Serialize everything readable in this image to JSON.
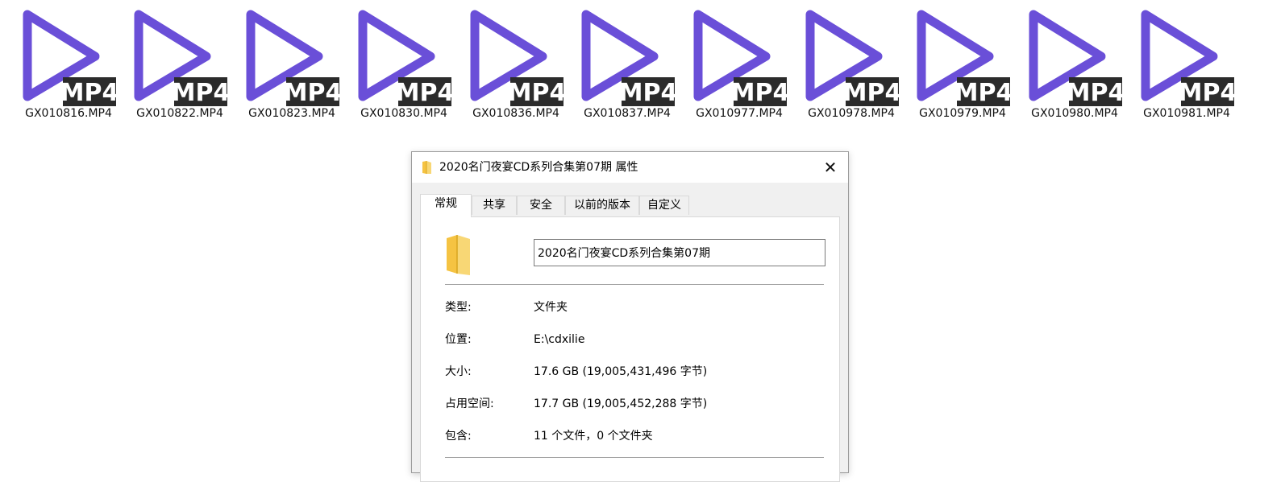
{
  "files": [
    {
      "name": "GX010816.MP4",
      "badge": "MP4",
      "icon": "mp4-play-icon"
    },
    {
      "name": "GX010822.MP4",
      "badge": "MP4",
      "icon": "mp4-play-icon"
    },
    {
      "name": "GX010823.MP4",
      "badge": "MP4",
      "icon": "mp4-play-icon"
    },
    {
      "name": "GX010830.MP4",
      "badge": "MP4",
      "icon": "mp4-play-icon"
    },
    {
      "name": "GX010836.MP4",
      "badge": "MP4",
      "icon": "mp4-play-icon"
    },
    {
      "name": "GX010837.MP4",
      "badge": "MP4",
      "icon": "mp4-play-icon"
    },
    {
      "name": "GX010977.MP4",
      "badge": "MP4",
      "icon": "mp4-play-icon"
    },
    {
      "name": "GX010978.MP4",
      "badge": "MP4",
      "icon": "mp4-play-icon"
    },
    {
      "name": "GX010979.MP4",
      "badge": "MP4",
      "icon": "mp4-play-icon"
    },
    {
      "name": "GX010980.MP4",
      "badge": "MP4",
      "icon": "mp4-play-icon"
    },
    {
      "name": "GX010981.MP4",
      "badge": "MP4",
      "icon": "mp4-play-icon"
    }
  ],
  "colors": {
    "play_icon": "#6a4fd8",
    "badge_bg": "#2b2b2b",
    "badge_text": "#ffffff",
    "folder": "#f5c342"
  },
  "dialog": {
    "title": "2020名门夜宴CD系列合集第07期 属性",
    "close_label": "✕",
    "tabs": [
      {
        "label": "常规",
        "active": true
      },
      {
        "label": "共享",
        "active": false
      },
      {
        "label": "安全",
        "active": false
      },
      {
        "label": "以前的版本",
        "active": false
      },
      {
        "label": "自定义",
        "active": false
      }
    ],
    "folder_name": "2020名门夜宴CD系列合集第07期",
    "properties": {
      "type": {
        "label": "类型:",
        "value": "文件夹"
      },
      "location": {
        "label": "位置:",
        "value": "E:\\cdxilie"
      },
      "size": {
        "label": "大小:",
        "value": "17.6 GB (19,005,431,496 字节)"
      },
      "size_on_disk": {
        "label": "占用空间:",
        "value": "17.7 GB (19,005,452,288 字节)"
      },
      "contains": {
        "label": "包含:",
        "value": "11 个文件，0 个文件夹"
      }
    }
  }
}
